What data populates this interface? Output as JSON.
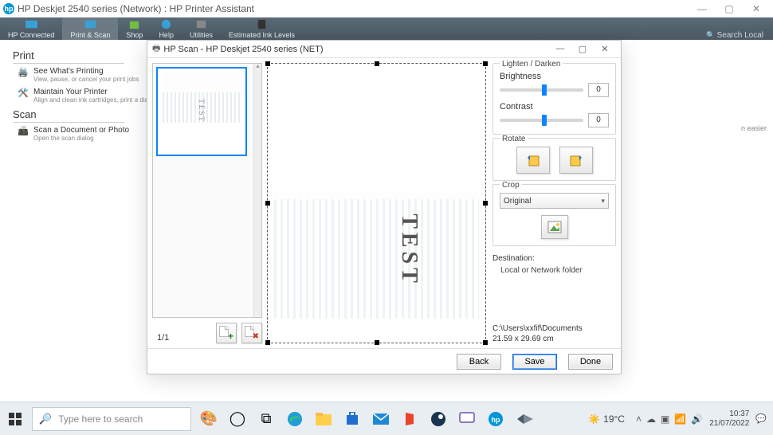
{
  "titlebar": {
    "text": "HP Deskjet 2540 series (Network) : HP Printer Assistant"
  },
  "ribbon": {
    "items": [
      "HP Connected",
      "Print & Scan",
      "Shop",
      "Help",
      "Utilities",
      "Estimated Ink Levels"
    ],
    "search": "Search Local"
  },
  "assist": {
    "print_header": "Print",
    "print_items": [
      {
        "title": "See What's Printing",
        "desc": "View, pause, or cancel your print jobs"
      },
      {
        "title": "Maintain Your Printer",
        "desc": "Align and clean ink cartridges, print a diagnostic page"
      }
    ],
    "scan_header": "Scan",
    "scan_items": [
      {
        "title": "Scan a Document or Photo",
        "desc": "Open the scan dialog"
      }
    ],
    "easier_hint": "n easier"
  },
  "scan": {
    "title": "HP Scan - HP Deskjet 2540 series (NET)",
    "page_counter": "1/1",
    "preview_text": "TEST",
    "panel": {
      "lighten_label": "Lighten / Darken",
      "brightness_label": "Brightness",
      "brightness_value": "0",
      "contrast_label": "Contrast",
      "contrast_value": "0",
      "rotate_label": "Rotate",
      "crop_label": "Crop",
      "crop_value": "Original",
      "destination_label": "Destination:",
      "destination_value": "Local or Network folder",
      "path": "C:\\Users\\xxfif\\Documents",
      "dimensions": "21.59 x 29.69 cm"
    },
    "buttons": {
      "back": "Back",
      "save": "Save",
      "done": "Done"
    }
  },
  "taskbar": {
    "search_placeholder": "Type here to search",
    "weather": "19°C",
    "time": "10:37",
    "date": "21/07/2022"
  }
}
